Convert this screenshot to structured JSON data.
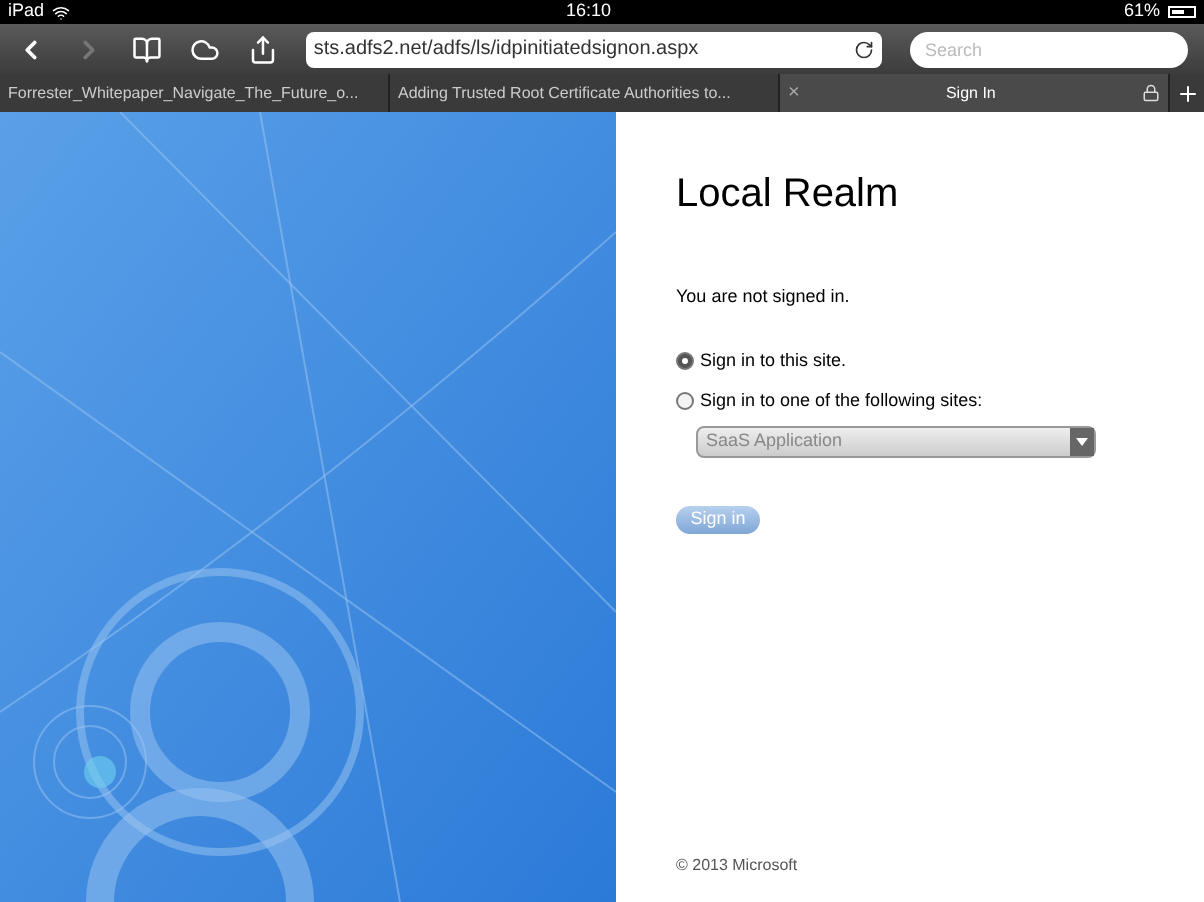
{
  "status_bar": {
    "device": "iPad",
    "time": "16:10",
    "battery": "61%"
  },
  "toolbar": {
    "url": "sts.adfs2.net/adfs/ls/idpinitiatedsignon.aspx",
    "search": {
      "placeholder": "Search"
    }
  },
  "tabs": [
    {
      "label": "Forrester_Whitepaper_Navigate_The_Future_o...",
      "selected": false
    },
    {
      "label": "Adding Trusted Root Certificate Authorities to...",
      "selected": false
    },
    {
      "label": "Sign In",
      "selected": true,
      "close": "×"
    }
  ],
  "page": {
    "title": "Local Realm",
    "message": "You are not signed in.",
    "options": [
      {
        "label": "Sign in to this site.",
        "selected": true
      },
      {
        "label": "Sign in to one of the following sites:",
        "selected": false
      }
    ],
    "dropdown": {
      "value": "SaaS Application"
    },
    "button": "Sign in",
    "footer": "© 2013 Microsoft"
  }
}
